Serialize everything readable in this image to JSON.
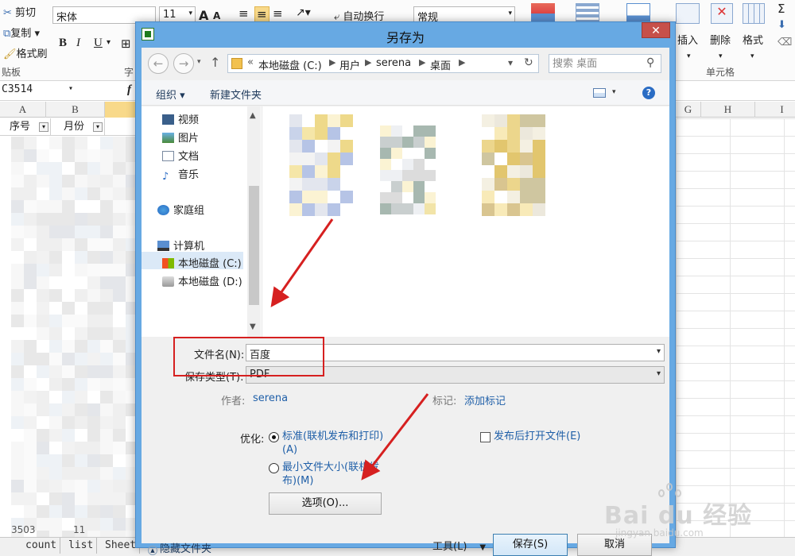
{
  "ribbon": {
    "clipboard": {
      "cut": "剪切",
      "copy": "复制",
      "format_painter": "格式刷",
      "label": "贴板"
    },
    "font_name": "宋体",
    "font_size": "11",
    "font_grow": "A",
    "font_shrink": "A",
    "bold": "B",
    "italic": "I",
    "underline": "U",
    "font_group_label": "字",
    "wrap_text": "自动换行",
    "number_format": "常规",
    "insert": "插入",
    "delete": "删除",
    "format": "格式",
    "cells_label": "单元格",
    "sigma": "Σ"
  },
  "formula_bar": {
    "name_box": "C3514",
    "fx": "f"
  },
  "sheet": {
    "columns": [
      "A",
      "B",
      "G",
      "H",
      "I"
    ],
    "headers": [
      {
        "label": "序号"
      },
      {
        "label": "月份"
      }
    ],
    "bottom_row_a": "3503",
    "bottom_row_b": "11"
  },
  "sheet_tabs": [
    "count",
    "list",
    "Sheet"
  ],
  "dialog": {
    "title": "另存为",
    "close_glyph": "✕",
    "address": {
      "chevron": "«",
      "segments": [
        "本地磁盘 (C:)",
        "用户",
        "serena",
        "桌面"
      ]
    },
    "search_placeholder": "搜索 桌面",
    "toolbar": {
      "organize": "组织",
      "new_folder": "新建文件夹"
    },
    "nav_items": [
      {
        "label": "视频"
      },
      {
        "label": "图片"
      },
      {
        "label": "文档"
      },
      {
        "label": "音乐"
      },
      {
        "label": "家庭组"
      },
      {
        "label": "计算机"
      },
      {
        "label": "本地磁盘 (C:)"
      },
      {
        "label": "本地磁盘 (D:)"
      }
    ],
    "form": {
      "file_name_label": "文件名(N):",
      "file_name_value": "百度",
      "save_type_label": "保存类型(T):",
      "save_type_value": "PDF",
      "author_label": "作者:",
      "author_value": "serena",
      "tags_label": "标记:",
      "tags_value": "添加标记",
      "optimize_label": "优化:",
      "option_standard": "标准(联机发布和打印)(A)",
      "option_minimum": "最小文件大小(联机发布)(M)",
      "open_after_publish": "发布后打开文件(E)",
      "options_button": "选项(O)...",
      "hide_folders": "隐藏文件夹",
      "tools": "工具(L)",
      "save": "保存(S)",
      "cancel": "取消"
    }
  },
  "colors": {
    "title_bar": "#67a9e3",
    "close_button": "#c7504a",
    "link": "#1f5fa8",
    "annotation": "#d62020"
  },
  "watermark": {
    "brand": "Bai du",
    "sub": "经验",
    "url": "jingyan.baidu.com"
  }
}
